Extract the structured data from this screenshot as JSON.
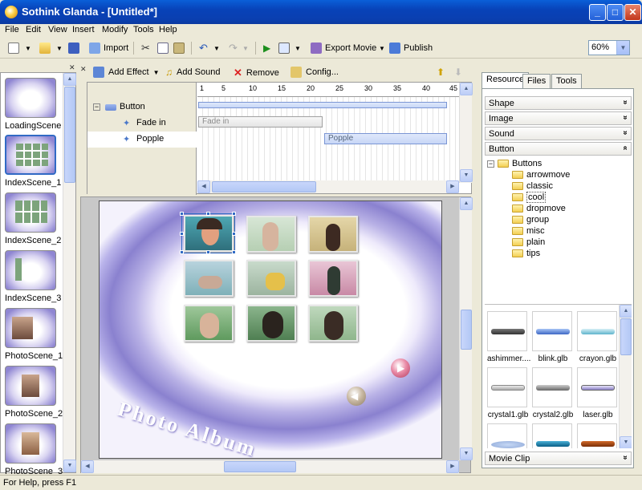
{
  "window": {
    "title": "Sothink Glanda - [Untitled*]",
    "minimize": "_",
    "maximize": "□",
    "close": "✕"
  },
  "menu": [
    "File",
    "Edit",
    "View",
    "Insert",
    "Modify",
    "Tools",
    "Help"
  ],
  "toolbar": {
    "import_label": "Import",
    "export_label": "Export Movie",
    "publish_label": "Publish",
    "zoom_value": "60%"
  },
  "scenes": [
    {
      "label": "LoadingScene",
      "selected": false
    },
    {
      "label": "IndexScene_1",
      "selected": true
    },
    {
      "label": "IndexScene_2",
      "selected": false
    },
    {
      "label": "IndexScene_3",
      "selected": false
    },
    {
      "label": "PhotoScene_1",
      "selected": false
    },
    {
      "label": "PhotoScene_2",
      "selected": false
    },
    {
      "label": "PhotoScene_3",
      "selected": false
    }
  ],
  "timeline": {
    "add_effect_label": "Add Effect",
    "add_sound_label": "Add Sound",
    "remove_label": "Remove",
    "config_label": "Config...",
    "tree": [
      {
        "label": "Button"
      },
      {
        "label": "Fade in"
      },
      {
        "label": "Popple"
      }
    ],
    "ruler_ticks": [
      "1",
      "5",
      "10",
      "15",
      "20",
      "25",
      "30",
      "35",
      "40",
      "45"
    ],
    "effects": [
      {
        "label": "Fade in"
      },
      {
        "label": "Popple"
      }
    ]
  },
  "stage": {
    "album_title": "Photo Album"
  },
  "resource_panel": {
    "tabs": [
      "Resource",
      "Files",
      "Tools"
    ],
    "categories": [
      "Shape",
      "Image",
      "Sound",
      "Button"
    ],
    "folder_root": "Buttons",
    "folders": [
      "arrowmove",
      "classic",
      "cool",
      "dropmove",
      "group",
      "misc",
      "plain",
      "tips"
    ],
    "selected_folder": "cool",
    "gallery": [
      "ashimmer....",
      "blink.glb",
      "crayon.glb",
      "crystal1.glb",
      "crystal2.glb",
      "laser.glb"
    ],
    "bottom_category": "Movie Clip",
    "collapse_chevron": "»",
    "expand_chevron": "«"
  },
  "status": {
    "text": "For Help, press F1"
  }
}
